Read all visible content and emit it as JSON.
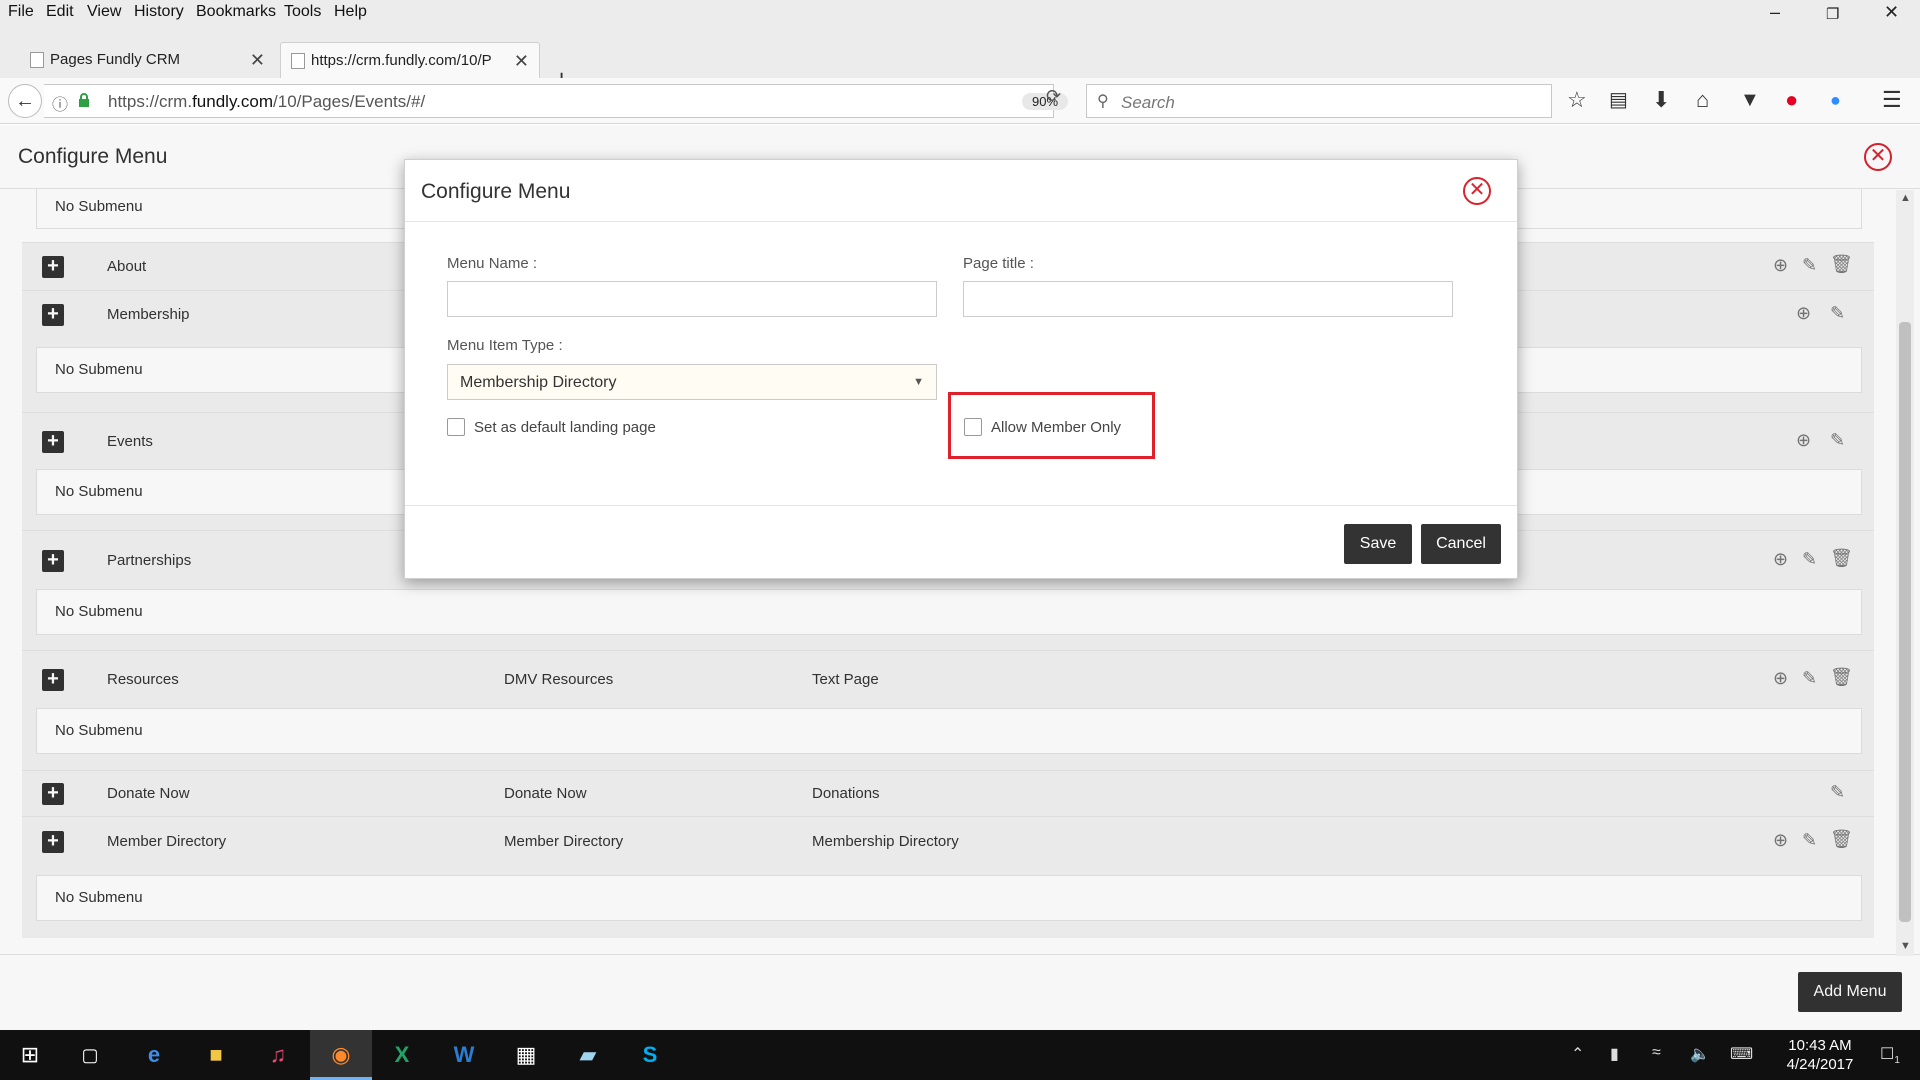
{
  "menubar": {
    "items": [
      "File",
      "Edit",
      "View",
      "History",
      "Bookmarks",
      "Tools",
      "Help"
    ],
    "window_controls": [
      "minimize-icon",
      "restore-icon",
      "close-icon"
    ]
  },
  "tabs": [
    {
      "label": "Pages Fundly CRM",
      "active": false
    },
    {
      "label": "https://crm.fundly.com/10/P",
      "active": true
    }
  ],
  "navbar": {
    "url_prefix": "https://crm.",
    "url_domain": "fundly.com",
    "url_suffix": "/10/Pages/Events/#/",
    "zoom": "90%",
    "search_placeholder": "Search"
  },
  "page": {
    "title": "Configure Menu",
    "add_menu_label": "Add Menu",
    "rows": [
      {
        "name": "About",
        "c2": "",
        "c3": "",
        "actions": [
          "add",
          "edit",
          "delete"
        ]
      },
      {
        "name": "Membership",
        "c2": "",
        "c3": "",
        "actions": [
          "add",
          "edit"
        ]
      },
      {
        "name": "Events",
        "c2": "",
        "c3": "",
        "actions": [
          "add",
          "edit"
        ]
      },
      {
        "name": "Partnerships",
        "c2": "",
        "c3": "",
        "actions": [
          "add",
          "edit",
          "delete"
        ]
      },
      {
        "name": "Resources",
        "c2": "DMV Resources",
        "c3": "Text Page",
        "actions": [
          "add",
          "edit",
          "delete"
        ]
      },
      {
        "name": "Donate Now",
        "c2": "Donate Now",
        "c3": "Donations",
        "actions": [
          "edit"
        ]
      },
      {
        "name": "Member Directory",
        "c2": "Member Directory",
        "c3": "Membership Directory",
        "actions": [
          "add",
          "edit",
          "delete"
        ]
      }
    ],
    "submenu_text": "No Submenu"
  },
  "modal": {
    "title": "Configure Menu",
    "menu_name_label": "Menu Name :",
    "menu_name_value": "",
    "page_title_label": "Page title :",
    "page_title_value": "",
    "menu_item_type_label": "Menu Item Type :",
    "menu_item_type_value": "Membership Directory",
    "default_landing_label": "Set as default landing page",
    "allow_member_only_label": "Allow Member Only",
    "save_label": "Save",
    "cancel_label": "Cancel",
    "highlight_color": "#e0202a"
  },
  "taskbar": {
    "time": "10:43 AM",
    "date": "4/24/2017",
    "notification_count": "1"
  },
  "colors": {
    "accent_red": "#d9232e",
    "button_dark": "#333333"
  }
}
